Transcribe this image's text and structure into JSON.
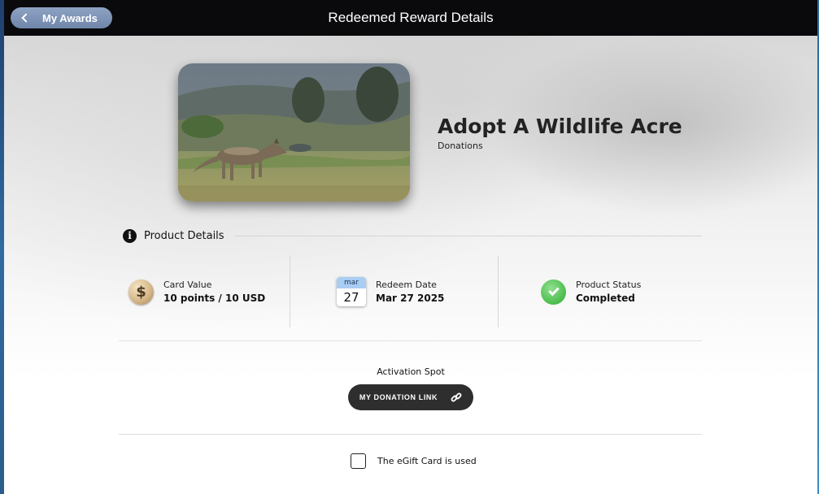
{
  "header": {
    "back_label": "My Awards",
    "title": "Redeemed Reward Details"
  },
  "product": {
    "name": "Adopt A Wildlife Acre",
    "category": "Donations",
    "image_icon": "wolf-photo"
  },
  "section": {
    "title": "Product Details",
    "icon": "info-icon"
  },
  "details": {
    "card_value": {
      "label": "Card Value",
      "value": "10 points / 10 USD",
      "icon": "dollar-coin-icon",
      "symbol": "$"
    },
    "redeem_date": {
      "label": "Redeem Date",
      "value": "Mar 27 2025",
      "icon": "calendar-icon",
      "month": "mar",
      "day": "27"
    },
    "status": {
      "label": "Product Status",
      "value": "Completed",
      "icon": "check-circle-icon",
      "color": "#4cbc4c"
    }
  },
  "activation": {
    "label": "Activation Spot",
    "button_label": "MY DONATION LINK",
    "button_icon": "link-icon"
  },
  "used": {
    "label": "The eGift Card is used",
    "checked": false
  },
  "colors": {
    "topbar": "#0a0a0d",
    "back_button": "#7a90b3",
    "donation_button": "#2e2e2e"
  }
}
